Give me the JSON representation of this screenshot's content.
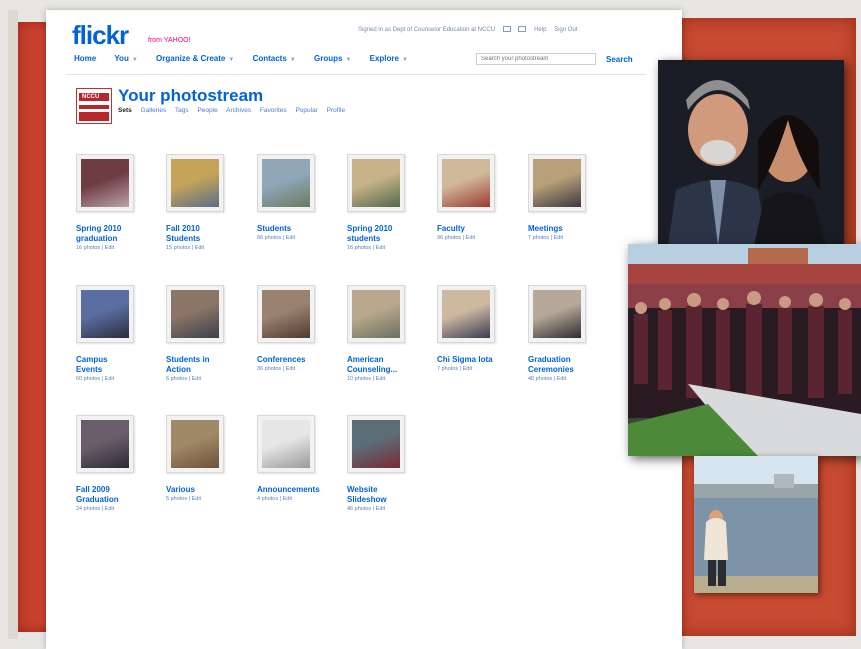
{
  "app": {
    "logo_main": "flickr",
    "logo_sub": "from YAHOO!"
  },
  "topbar": {
    "signed_in_text": "Signed in as Dept of Counselor Education at NCCU",
    "help": "Help",
    "sign_out": "Sign Out"
  },
  "nav": {
    "items": [
      {
        "label": "Home"
      },
      {
        "label": "You"
      },
      {
        "label": "Organize & Create"
      },
      {
        "label": "Contacts"
      },
      {
        "label": "Groups"
      },
      {
        "label": "Explore"
      }
    ],
    "search_placeholder": "Search your photostream",
    "search_button": "Search"
  },
  "header": {
    "buddy_text": "NCCU",
    "title": "Your photostream",
    "subnav": [
      {
        "label": "Sets",
        "active": true
      },
      {
        "label": "Galleries"
      },
      {
        "label": "Tags"
      },
      {
        "label": "People"
      },
      {
        "label": "Archives"
      },
      {
        "label": "Favorites"
      },
      {
        "label": "Popular"
      },
      {
        "label": "Profile"
      }
    ]
  },
  "sets": [
    {
      "title": "Spring 2010\ngraduation",
      "meta": "16 photos | Edit",
      "palette": [
        "#6f3c44",
        "#b9a4a6"
      ]
    },
    {
      "title": "Fall 2010\nStudents",
      "meta": "15 photos | Edit",
      "palette": [
        "#c5a45a",
        "#5b6e86"
      ]
    },
    {
      "title": "Students",
      "meta": "66 photos | Edit",
      "palette": [
        "#8fa7b9",
        "#6b7a62"
      ]
    },
    {
      "title": "Spring 2010\nstudents",
      "meta": "16 photos | Edit",
      "palette": [
        "#c7b28a",
        "#536a4a"
      ]
    },
    {
      "title": "Faculty",
      "meta": "96 photos | Edit",
      "palette": [
        "#d0b89a",
        "#9c3a30"
      ]
    },
    {
      "title": "Meetings",
      "meta": "7 photos | Edit",
      "palette": [
        "#b8a07a",
        "#3a3a3a"
      ]
    },
    {
      "title": "Campus\nEvents",
      "meta": "60 photos | Edit",
      "palette": [
        "#5b6ea2",
        "#2a2c3c"
      ]
    },
    {
      "title": "Students in\nAction",
      "meta": "6 photos | Edit",
      "palette": [
        "#8a7566",
        "#3d3f4d"
      ]
    },
    {
      "title": "Conferences",
      "meta": "36 photos | Edit",
      "palette": [
        "#9a8270",
        "#4f3a2e"
      ]
    },
    {
      "title": "American\nCounseling...",
      "meta": "10 photos | Edit",
      "palette": [
        "#b9a88e",
        "#6c6f5d"
      ]
    },
    {
      "title": "Chi Sigma Iota",
      "meta": "7 photos | Edit",
      "palette": [
        "#cdb9a0",
        "#3b3c52"
      ]
    },
    {
      "title": "Graduation\nCeremonies",
      "meta": "48 photos | Edit",
      "palette": [
        "#b6a99a",
        "#2f2b30"
      ]
    },
    {
      "title": "Fall 2009\nGraduation",
      "meta": "24 photos | Edit",
      "palette": [
        "#6a5d6a",
        "#2c2a36"
      ]
    },
    {
      "title": "Various",
      "meta": "5 photos | Edit",
      "palette": [
        "#a08966",
        "#70503a"
      ]
    },
    {
      "title": "Announcements",
      "meta": "4 photos | Edit",
      "palette": [
        "#e6e6e6",
        "#9a9a9a"
      ]
    },
    {
      "title": "Website\nSlideshow",
      "meta": "46 photos | Edit",
      "palette": [
        "#5b6d77",
        "#792a35"
      ]
    }
  ],
  "colors": {
    "flickr_blue": "#0063dc",
    "flickr_pink": "#ff0084",
    "backdrop_red": "#c84a30"
  }
}
